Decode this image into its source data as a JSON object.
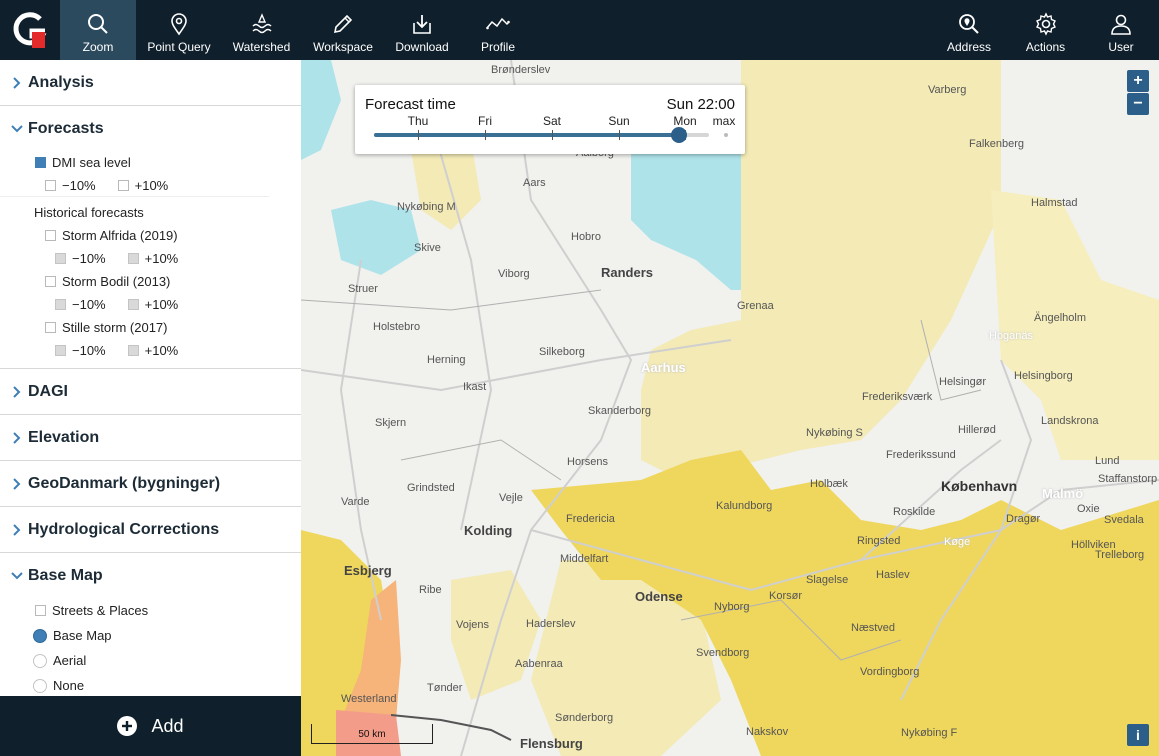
{
  "toolbar": {
    "tools": [
      {
        "label": "Zoom",
        "icon": "search-icon"
      },
      {
        "label": "Point Query",
        "icon": "map-pin-icon"
      },
      {
        "label": "Watershed",
        "icon": "water-icon"
      },
      {
        "label": "Workspace",
        "icon": "pencil-icon"
      },
      {
        "label": "Download",
        "icon": "download-icon"
      },
      {
        "label": "Profile",
        "icon": "profile-line-icon"
      }
    ],
    "right_tools": [
      {
        "label": "Address",
        "icon": "address-search-icon"
      },
      {
        "label": "Actions",
        "icon": "gear-icon"
      },
      {
        "label": "User",
        "icon": "user-icon"
      }
    ],
    "accent_color": "#e32b2b",
    "active_color": "#2b4a5e"
  },
  "sidebar": {
    "analysis": "Analysis",
    "forecasts": {
      "title": "Forecasts",
      "dmi": "DMI sea level",
      "minus": "−10%",
      "plus": "+10%",
      "historical_title": "Historical forecasts",
      "storms": [
        {
          "name": "Storm Alfrida (2019)"
        },
        {
          "name": "Storm Bodil (2013)"
        },
        {
          "name": "Stille storm (2017)"
        }
      ]
    },
    "dagi": "DAGI",
    "elevation": "Elevation",
    "geodanmark": "GeoDanmark (bygninger)",
    "hydro": "Hydrological Corrections",
    "basemap": {
      "title": "Base Map",
      "streets": "Streets & Places",
      "options": [
        "Base Map",
        "Aerial",
        "None"
      ],
      "selected": "Base Map"
    },
    "add_label": "Add"
  },
  "map": {
    "zoom_in": "+",
    "zoom_out": "−",
    "info": "i",
    "scale": "50 km",
    "forecast": {
      "title": "Forecast time",
      "current": "Sun 22:00",
      "days": [
        "Thu",
        "Fri",
        "Sat",
        "Sun",
        "Mon",
        "max"
      ],
      "progress": 0.91
    },
    "labels": {
      "bronderslev": "Brønderslev",
      "aalborg": "Aalborg",
      "aars": "Aars",
      "nykobing_m": "Nykøbing M",
      "hobro": "Hobro",
      "skive": "Skive",
      "viborg": "Viborg",
      "randers": "Randers",
      "struer": "Struer",
      "grenaa": "Grenaa",
      "holstebro": "Holstebro",
      "herning": "Herning",
      "silkeborg": "Silkeborg",
      "aarhus": "Aarhus",
      "ikast": "Ikast",
      "skanderborg": "Skanderborg",
      "skjern": "Skjern",
      "horsens": "Horsens",
      "grindsted": "Grindsted",
      "vejle": "Vejle",
      "varde": "Varde",
      "kolding": "Kolding",
      "fredericia": "Fredericia",
      "esbjerg": "Esbjerg",
      "middelfart": "Middelfart",
      "ribe": "Ribe",
      "odense": "Odense",
      "vojens": "Vojens",
      "haderslev": "Haderslev",
      "nyborg": "Nyborg",
      "svendborg": "Svendborg",
      "aabenraa": "Aabenraa",
      "tonder": "Tønder",
      "westerland": "Westerland",
      "sonderborg": "Sønderborg",
      "flensburg": "Flensburg",
      "varberg": "Varberg",
      "falkenberg": "Falkenberg",
      "halmstad": "Halmstad",
      "angelholm": "Ängelholm",
      "hoganas": "Höganäs",
      "helsingor": "Helsingør",
      "helsingborg": "Helsingborg",
      "frederiksvaerk": "Frederiksværk",
      "hillerod": "Hillerød",
      "nykobing_s": "Nykøbing S",
      "frederikssund": "Frederikssund",
      "landskrona": "Landskrona",
      "lund": "Lund",
      "staffanstorp": "Staffanstorp",
      "kalundborg": "Kalundborg",
      "holbaek": "Holbæk",
      "roskilde": "Roskilde",
      "kobenhavn": "København",
      "malmo": "Malmö",
      "oxie": "Oxie",
      "dragor": "Dragør",
      "svedala": "Svedala",
      "ringsted": "Ringsted",
      "koge": "Køge",
      "hollviken": "Höllviken",
      "trelleborg": "Trelleborg",
      "slagelse": "Slagelse",
      "haslev": "Haslev",
      "korsor": "Korsør",
      "naestved": "Næstved",
      "vordingborg": "Vordingborg",
      "nakskov": "Nakskov",
      "nykobing_f": "Nykøbing F"
    }
  }
}
